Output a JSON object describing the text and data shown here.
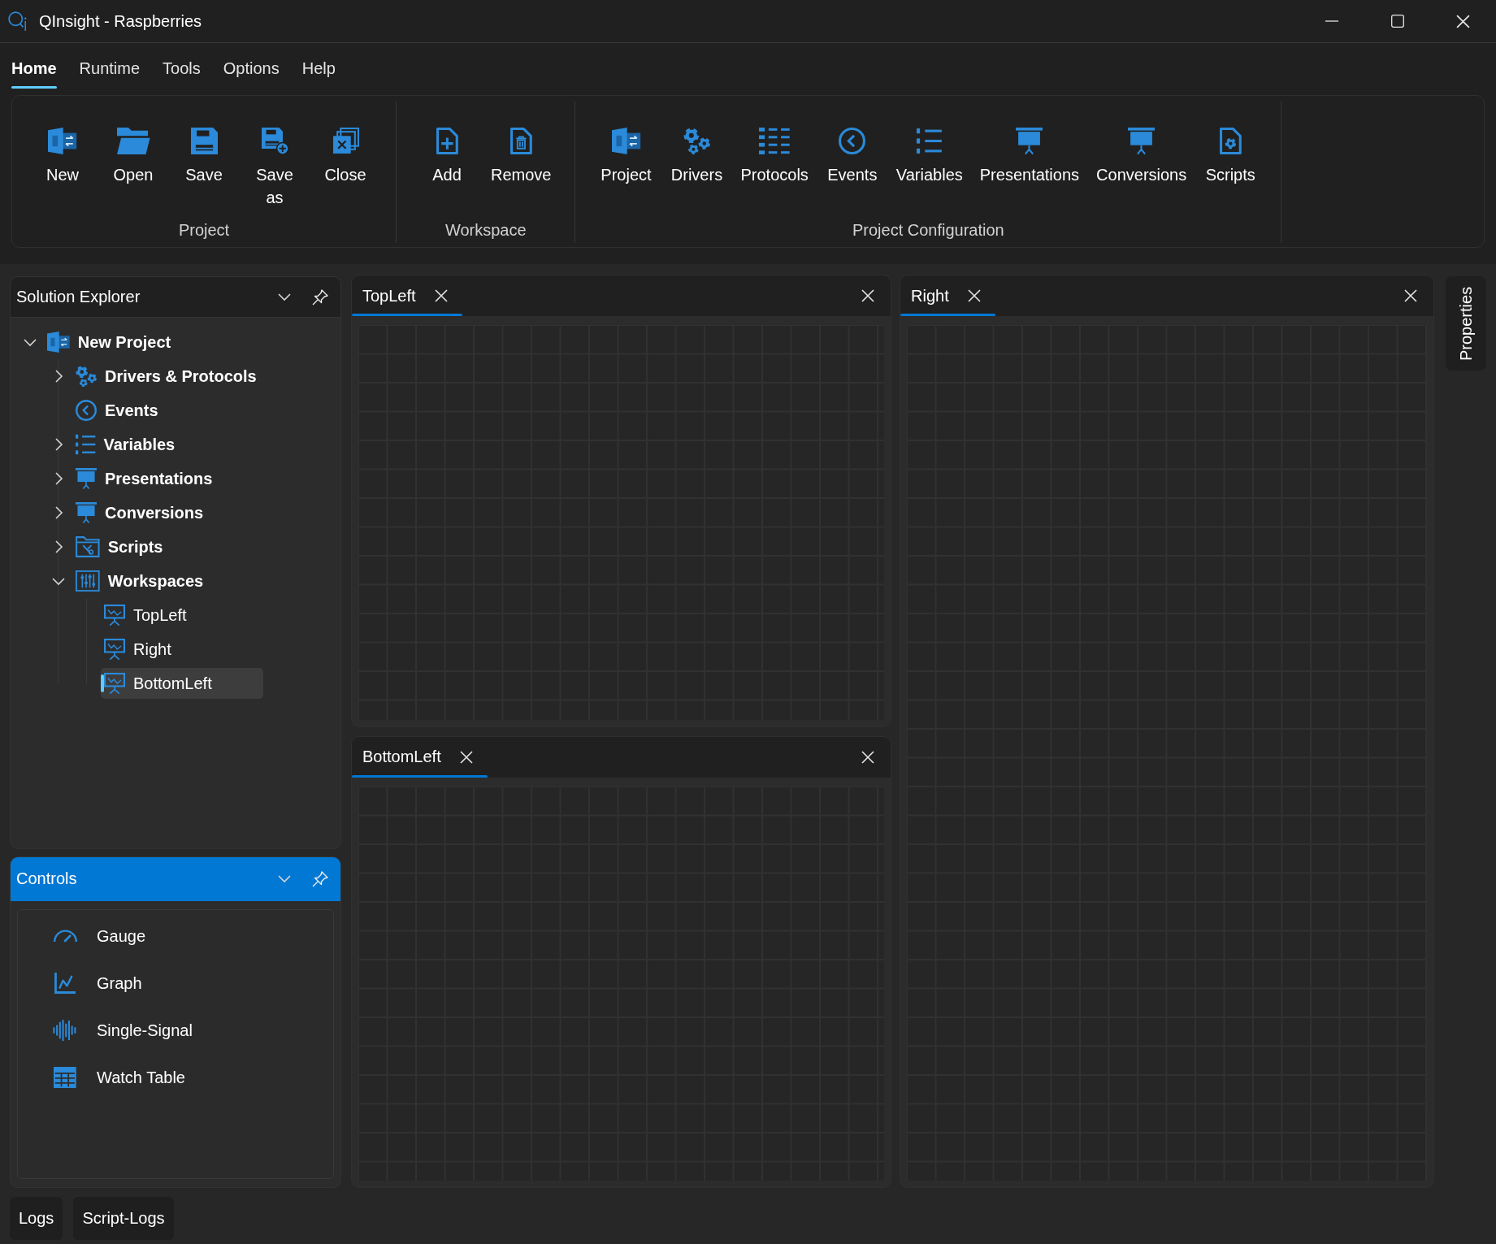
{
  "window": {
    "title": "QInsight - Raspberries"
  },
  "menu_tabs": [
    {
      "label": "Home",
      "selected": true
    },
    {
      "label": "Runtime",
      "selected": false
    },
    {
      "label": "Tools",
      "selected": false
    },
    {
      "label": "Options",
      "selected": false
    },
    {
      "label": "Help",
      "selected": false
    }
  ],
  "ribbon": {
    "groups": [
      {
        "label": "Project",
        "buttons": [
          "New",
          "Open",
          "Save",
          "Save as",
          "Close"
        ]
      },
      {
        "label": "Workspace",
        "buttons": [
          "Add",
          "Remove"
        ]
      },
      {
        "label": "Project Configuration",
        "buttons": [
          "Project",
          "Drivers",
          "Protocols",
          "Events",
          "Variables",
          "Presentations",
          "Conversions",
          "Scripts"
        ]
      }
    ]
  },
  "solution_explorer": {
    "title": "Solution Explorer",
    "active": false,
    "tree": [
      {
        "label": "New Project",
        "kind": "folder",
        "expanded": true,
        "selected": false,
        "children": [
          {
            "label": "Drivers & Protocols",
            "kind": "folder",
            "expanded": false,
            "selected": false
          },
          {
            "label": "Events",
            "kind": "item",
            "selected": false
          },
          {
            "label": "Variables",
            "kind": "folder",
            "expanded": false,
            "selected": false
          },
          {
            "label": "Presentations",
            "kind": "folder",
            "expanded": false,
            "selected": false
          },
          {
            "label": "Conversions",
            "kind": "folder",
            "expanded": false,
            "selected": false
          },
          {
            "label": "Scripts",
            "kind": "folder",
            "expanded": false,
            "selected": false
          },
          {
            "label": "Workspaces",
            "kind": "folder",
            "expanded": true,
            "selected": false,
            "children": [
              {
                "label": "TopLeft",
                "kind": "item",
                "selected": false
              },
              {
                "label": "Right",
                "kind": "item",
                "selected": false
              },
              {
                "label": "BottomLeft",
                "kind": "item",
                "selected": true
              }
            ]
          }
        ]
      }
    ]
  },
  "controls_panel": {
    "title": "Controls",
    "active": true,
    "items": [
      "Gauge",
      "Graph",
      "Single-Signal",
      "Watch Table"
    ]
  },
  "bottom_tabs": [
    "Logs",
    "Script-Logs"
  ],
  "documents": {
    "left_column": [
      {
        "tabs": [
          {
            "label": "TopLeft",
            "selected": true
          }
        ]
      },
      {
        "tabs": [
          {
            "label": "BottomLeft",
            "selected": true
          }
        ]
      }
    ],
    "right_column": [
      {
        "tabs": [
          {
            "label": "Right",
            "selected": true
          }
        ]
      }
    ]
  },
  "side_tabs": [
    "Properties"
  ]
}
